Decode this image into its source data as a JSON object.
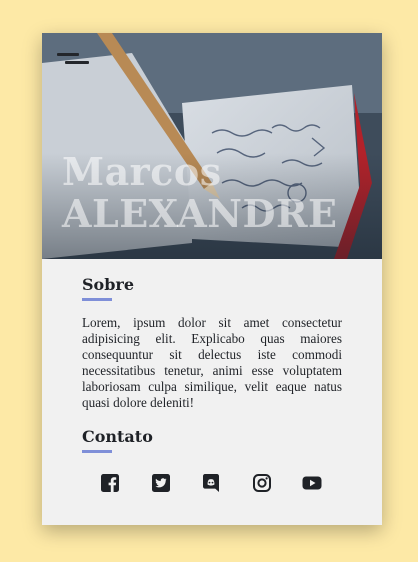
{
  "hero": {
    "first_name": "Marcos",
    "last_name": "ALEXANDRE"
  },
  "about": {
    "title": "Sobre",
    "text": "Lorem, ipsum dolor sit amet consectetur adipisicing elit. Explicabo quas maiores consequuntur sit delectus iste commodi necessitatibus tenetur, animi esse voluptatem laboriosam culpa similique, velit eaque natus quasi dolore deleniti!"
  },
  "contact": {
    "title": "Contato",
    "socials": [
      {
        "icon": "facebook-icon"
      },
      {
        "icon": "twitter-icon"
      },
      {
        "icon": "discord-icon"
      },
      {
        "icon": "instagram-icon"
      },
      {
        "icon": "youtube-icon"
      }
    ]
  },
  "colors": {
    "page_background": "#fde9a6",
    "card_background": "#f1f1f1",
    "accent_underline": "#7f8fd8",
    "text": "#1f2227"
  }
}
